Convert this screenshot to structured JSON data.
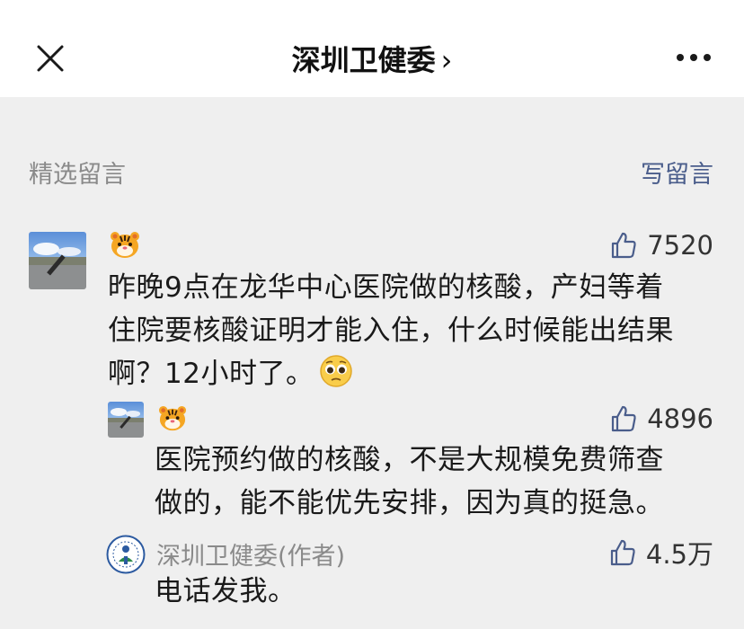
{
  "header": {
    "title": "深圳卫健委",
    "chevron": "›"
  },
  "section": {
    "title": "精选留言",
    "write_label": "写留言"
  },
  "comments": [
    {
      "likes": "7520",
      "text_lines": [
        "昨晚9点在龙华中心医院做的核酸，产妇等着",
        "住院要核酸证明才能入住，什么时候能出结果"
      ],
      "text_last": "啊？12小时了。",
      "reply": {
        "likes": "4896",
        "text_lines": [
          "医院预约做的核酸，不是大规模免费筛查",
          "做的，能不能优先安排，因为真的挺急。"
        ]
      },
      "author_reply": {
        "name": "深圳卫健委(作者)",
        "likes": "4.5万",
        "text": "电话发我。"
      }
    }
  ],
  "colors": {
    "link": "#4a5d8b",
    "muted": "#8a8a8a",
    "background": "#efefef"
  },
  "icons": [
    "close-icon",
    "more-icon",
    "thumbs-up-icon",
    "tiger-emoji",
    "pleading-face-emoji",
    "health-commission-logo"
  ]
}
